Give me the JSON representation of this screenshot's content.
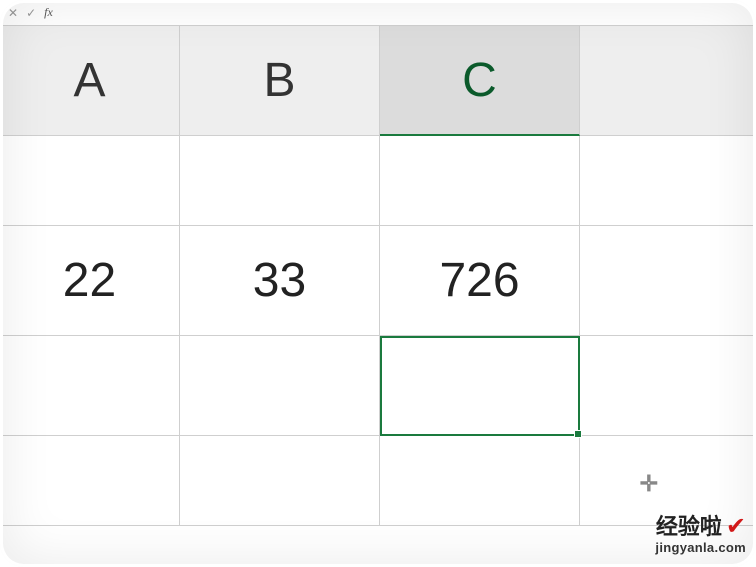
{
  "formula_bar": {
    "cancel": "✕",
    "confirm": "✓",
    "fx": "fx",
    "value": ""
  },
  "headers": {
    "a": "A",
    "b": "B",
    "c": "C",
    "d": ""
  },
  "rows": [
    {
      "a": "",
      "b": "",
      "c": "",
      "d": ""
    },
    {
      "a": "22",
      "b": "33",
      "c": "726",
      "d": ""
    },
    {
      "a": "",
      "b": "",
      "c": "",
      "d": ""
    },
    {
      "a": "",
      "b": "",
      "c": "",
      "d": ""
    }
  ],
  "cursor": {
    "glyph": "✛"
  },
  "watermark": {
    "title": "经验啦",
    "check": "✔",
    "url": "jingyanla.com"
  },
  "chart_data": {
    "type": "table",
    "columns": [
      "A",
      "B",
      "C"
    ],
    "rows": [
      [
        "",
        "",
        ""
      ],
      [
        22,
        33,
        726
      ],
      [
        "",
        "",
        ""
      ],
      [
        "",
        "",
        ""
      ]
    ],
    "selected_cell": "C3"
  }
}
